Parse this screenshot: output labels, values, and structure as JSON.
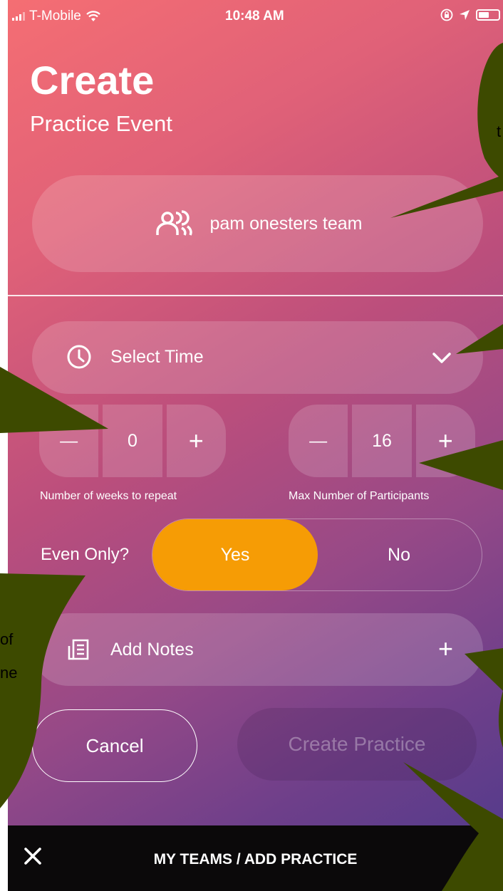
{
  "status_bar": {
    "carrier": "T-Mobile",
    "time": "10:48 AM"
  },
  "header": {
    "title": "Create",
    "subtitle": "Practice Event"
  },
  "team": {
    "name": "pam onesters team",
    "icon": "team-icon"
  },
  "time_select": {
    "label": "Select Time",
    "icon": "clock-icon"
  },
  "repeat_stepper": {
    "minus": "—",
    "value": "0",
    "plus": "+",
    "caption": "Number of weeks to repeat"
  },
  "participants_stepper": {
    "minus": "—",
    "value": "16",
    "plus": "+",
    "caption": "Max Number of Participants"
  },
  "even_only": {
    "label": "Even Only?",
    "yes": "Yes",
    "no": "No",
    "selected": "Yes"
  },
  "notes": {
    "label": "Add Notes",
    "plus": "+"
  },
  "actions": {
    "cancel": "Cancel",
    "create": "Create Practice"
  },
  "bottom_bar": {
    "breadcrumb": "MY TEAMS / ADD PRACTICE"
  },
  "colors": {
    "accent": "#f69c05",
    "callout": "#3d4a00"
  },
  "overlay_text": {
    "t": "t",
    "of": "of",
    "ne": "ne"
  }
}
